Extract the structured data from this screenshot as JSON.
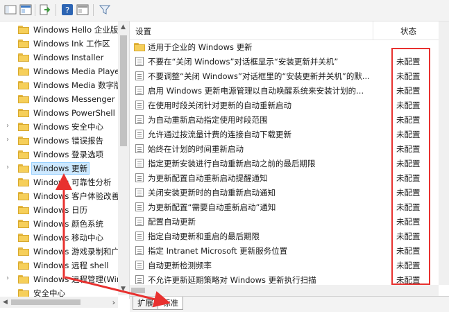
{
  "tree": {
    "items": [
      {
        "label": "Windows Hello 企业版",
        "expandable": false
      },
      {
        "label": "Windows Ink 工作区",
        "expandable": false
      },
      {
        "label": "Windows Installer",
        "expandable": false
      },
      {
        "label": "Windows Media Player",
        "expandable": false
      },
      {
        "label": "Windows Media 数字版权管理",
        "expandable": false
      },
      {
        "label": "Windows Messenger",
        "expandable": false
      },
      {
        "label": "Windows PowerShell",
        "expandable": false
      },
      {
        "label": "Windows 安全中心",
        "expandable": true
      },
      {
        "label": "Windows 错误报告",
        "expandable": true
      },
      {
        "label": "Windows 登录选项",
        "expandable": false
      },
      {
        "label": "Windows 更新",
        "expandable": true,
        "selected": true
      },
      {
        "label": "Windows 可靠性分析",
        "expandable": false
      },
      {
        "label": "Windows 客户体验改善计划",
        "expandable": false
      },
      {
        "label": "Windows 日历",
        "expandable": false
      },
      {
        "label": "Windows 颜色系统",
        "expandable": false
      },
      {
        "label": "Windows 移动中心",
        "expandable": false
      },
      {
        "label": "Windows 游戏录制和广播",
        "expandable": false
      },
      {
        "label": "Windows 远程 shell",
        "expandable": false
      },
      {
        "label": "Windows 远程管理(WinRM)",
        "expandable": true
      },
      {
        "label": "安全中心",
        "expandable": false
      }
    ]
  },
  "list": {
    "header": {
      "setting": "设置",
      "state": "状态"
    },
    "folder_row": "适用于企业的 Windows 更新",
    "rows": [
      {
        "text": "不要在“关闭 Windows”对话框显示“安装更新并关机”",
        "state": "未配置"
      },
      {
        "text": "不要调整“关闭 Windows”对话框里的“安装更新并关机”的默...",
        "state": "未配置"
      },
      {
        "text": "启用 Windows 更新电源管理以自动唤醒系统来安装计划的...",
        "state": "未配置"
      },
      {
        "text": "在使用时段关闭针对更新的自动重新启动",
        "state": "未配置"
      },
      {
        "text": "为自动重新启动指定使用时段范围",
        "state": "未配置"
      },
      {
        "text": "允许通过按流量计费的连接自动下载更新",
        "state": "未配置"
      },
      {
        "text": "始终在计划的时间重新启动",
        "state": "未配置"
      },
      {
        "text": "指定更新安装进行自动重新启动之前的最后期限",
        "state": "未配置"
      },
      {
        "text": "为更新配置自动重新启动提醒通知",
        "state": "未配置"
      },
      {
        "text": "关闭安装更新时的自动重新启动通知",
        "state": "未配置"
      },
      {
        "text": "为更新配置“需要自动重新启动”通知",
        "state": "未配置"
      },
      {
        "text": "配置自动更新",
        "state": "未配置"
      },
      {
        "text": "指定自动更新和重启的最后期限",
        "state": "未配置"
      },
      {
        "text": "指定 Intranet Microsoft 更新服务位置",
        "state": "未配置"
      },
      {
        "text": "自动更新检测频率",
        "state": "未配置"
      },
      {
        "text": "不允许更新延期策略对 Windows 更新执行扫描",
        "state": "未配置"
      }
    ]
  },
  "tabs": {
    "extended": "扩展",
    "standard": "标准"
  },
  "colors": {
    "annotation": "#e8312f",
    "folder": "#f6cf5a",
    "selection": "#cce8ff"
  },
  "toolbar": {
    "icons": [
      "back-icon",
      "forward-icon",
      "show-hide-tree-icon",
      "export-list-icon",
      "help-icon",
      "extended-view-icon",
      "filter-icon"
    ]
  }
}
